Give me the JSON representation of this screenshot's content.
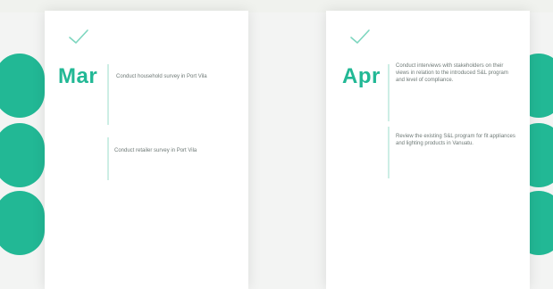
{
  "colors": {
    "accent": "#22b895",
    "card": "#ffffff",
    "background": "#f3f4f3",
    "text": "#6f7a77",
    "divider": "#cdeee5"
  },
  "cards": [
    {
      "icon": "checkmark-icon",
      "month": "Mar",
      "tasks": [
        "Conduct household survey in Port Vila",
        "Conduct retailer survey in Port Vila"
      ]
    },
    {
      "icon": "checkmark-icon",
      "month": "Apr",
      "tasks": [
        "Conduct interviews with stakeholders on their views in relation to the introduced S&L program and level of compliance.",
        "Review the existing S&L program for fit appliances and lighting products in Vanuatu."
      ]
    }
  ]
}
